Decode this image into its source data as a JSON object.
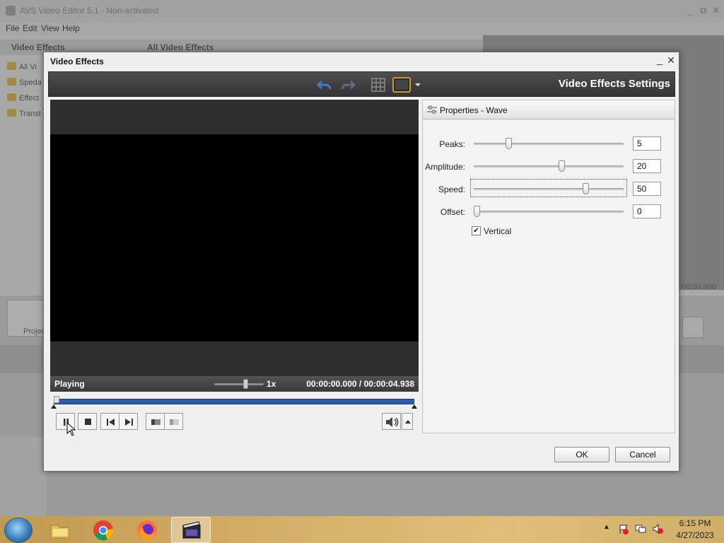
{
  "app": {
    "title": "AVS Video Editor 5.1 - Non-activated",
    "window_controls": [
      "_",
      "⧉",
      "✕"
    ],
    "menu": [
      "File",
      "Edit",
      "View",
      "Help"
    ],
    "panel_left": "Video Effects",
    "panel_mid": "All Video Effects",
    "tree": [
      "All Vi",
      "Speda",
      "Effect",
      "Transt"
    ],
    "project_label": "Projec",
    "right_time": "00:00.000"
  },
  "dialog": {
    "title": "Video Effects",
    "minimize": "_",
    "close": "✕",
    "settings_heading": "Video Effects Settings",
    "status": "Playing",
    "playback_rate": "1x",
    "time_current": "00:00:00.000",
    "time_separator": "/",
    "time_total": "00:00:04.938",
    "speed_slider_position": 0.6,
    "timeline_progress": 0.0,
    "properties": {
      "header": "Properties - Wave",
      "params": [
        {
          "label": "Peaks:",
          "value": "5",
          "slider": 0.22
        },
        {
          "label": "Amplitude:",
          "value": "20",
          "slider": 0.59
        },
        {
          "label": "Speed:",
          "value": "50",
          "slider": 0.76
        },
        {
          "label": "Offset:",
          "value": "0",
          "slider": 0.0
        }
      ],
      "vertical_label": "Vertical",
      "vertical_checked": true,
      "check_mark": "✔"
    },
    "ok_label": "OK",
    "cancel_label": "Cancel"
  },
  "taskbar": {
    "apps": [
      "start",
      "file-explorer",
      "chrome",
      "firefox",
      "avs-video-editor"
    ],
    "active_app": "avs-video-editor",
    "clock_time": "6:15 PM",
    "clock_date": "4/27/2023",
    "tray_arrow": "▲"
  },
  "colors": {
    "toolbar_dark": "#3a3a3a",
    "timeline_blue": "#2f5aa6",
    "taskbar_gold": "#d5b06a"
  }
}
